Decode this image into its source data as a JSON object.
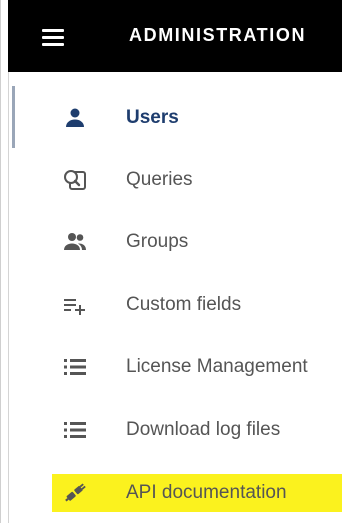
{
  "header": {
    "title": "ADMINISTRATION",
    "menu_icon": "hamburger-menu-icon"
  },
  "nav": {
    "items": [
      {
        "label": "Users",
        "icon": "person-icon",
        "active": true
      },
      {
        "label": "Queries",
        "icon": "query-icon",
        "active": false
      },
      {
        "label": "Groups",
        "icon": "group-icon",
        "active": false
      },
      {
        "label": "Custom fields",
        "icon": "playlist-add-icon",
        "active": false
      },
      {
        "label": "License Management",
        "icon": "list-icon",
        "active": false
      },
      {
        "label": "Download log files",
        "icon": "list-icon",
        "active": false
      },
      {
        "label": "API documentation",
        "icon": "plug-icon",
        "active": false,
        "highlighted": true
      }
    ]
  },
  "colors": {
    "header_bg": "#000000",
    "active_text": "#1e3d6e",
    "item_text": "#555555",
    "highlight": "#fbf21e"
  }
}
